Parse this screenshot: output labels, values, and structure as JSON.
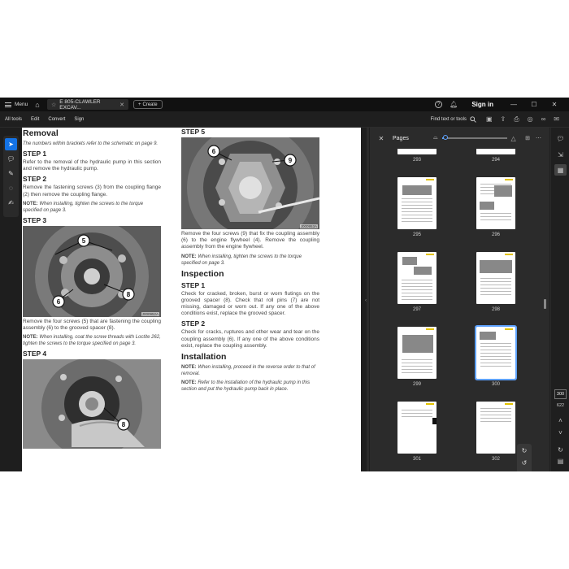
{
  "titlebar": {
    "menu_label": "Menu",
    "tab_title": "E 805-CLAWLER EXCAV...",
    "create_label": "Create",
    "sign_in_label": "Sign in"
  },
  "toolbar": {
    "items": [
      "All tools",
      "Edit",
      "Convert",
      "Sign"
    ],
    "find_label": "Find text or tools"
  },
  "document": {
    "col1": {
      "removal_heading": "Removal",
      "removal_note": "The numbers within brackets refer to the schematic on page 9.",
      "step1_heading": "STEP 1",
      "step1_text": "Refer to the removal of the hydraulic pump in this section and remove the hydraulic pump.",
      "step2_heading": "STEP 2",
      "step2_text": "Remove the fastening screws (3) from the coupling flange (2) then remove the coupling flange.",
      "step2_note_label": "NOTE:",
      "step2_note": "When installing, tighten the screws to the torque specified on page 3.",
      "step3_heading": "STEP 3",
      "photo1_code": "J000952A",
      "step3_text": "Remove the four screws (5) that are fastening the coupling assembly (6) to the grooved spacer (8).",
      "step3_note_label": "NOTE:",
      "step3_note": "When installing, coat the screw threads with Loctite 262, tighten the screws to the torque specified on page 3.",
      "step4_heading": "STEP 4"
    },
    "col2": {
      "step5_heading": "STEP 5",
      "photo_code": "J000953A",
      "step5_text": "Remove the four screws (9) that fix the coupling assembly (6) to the engine flywheel (4). Remove the coupling assembly from the engine flywheel.",
      "step5_note_label": "NOTE:",
      "step5_note": "When installing, tighten the screws to the torque specified on page 3.",
      "inspection_heading": "Inspection",
      "insp_step1_heading": "STEP 1",
      "insp_step1_text": "Check for cracked, broken, burst or worn flutings on the grooved spacer (8). Check that roll pins (7) are not missing, damaged or worn out. If any one of the above conditions exist, replace the grooved spacer.",
      "insp_step2_heading": "STEP 2",
      "insp_step2_text": "Check for cracks, ruptures and other wear and tear on the coupling assembly (6). If any one of the above conditions exist, replace the coupling assembly.",
      "installation_heading": "Installation",
      "inst_note1_label": "NOTE:",
      "inst_note1": "When installing, proceed in the reverse order to that of removal.",
      "inst_note2_label": "NOTE:",
      "inst_note2": "Refer to the installation of the hydraulic pump in this section and put the hydraulic pump back in place."
    },
    "callouts": {
      "photo1": [
        "5",
        "8",
        "6"
      ],
      "photo2": [
        "8"
      ],
      "photo3": [
        "6",
        "9"
      ]
    }
  },
  "pages_panel": {
    "title": "Pages",
    "zoom_level": 0.05,
    "pages": [
      "293",
      "294",
      "295",
      "296",
      "297",
      "298",
      "299",
      "300",
      "301",
      "302"
    ],
    "selected_page": "300"
  },
  "navigation": {
    "current_page": "300",
    "total_pages": "622"
  },
  "colors": {
    "accent": "#1473e6",
    "selection": "#5ea2ff",
    "app_bg": "#1e1e1e",
    "panel_bg": "#2b2b2b",
    "thumb_marker": "#e2c200"
  }
}
